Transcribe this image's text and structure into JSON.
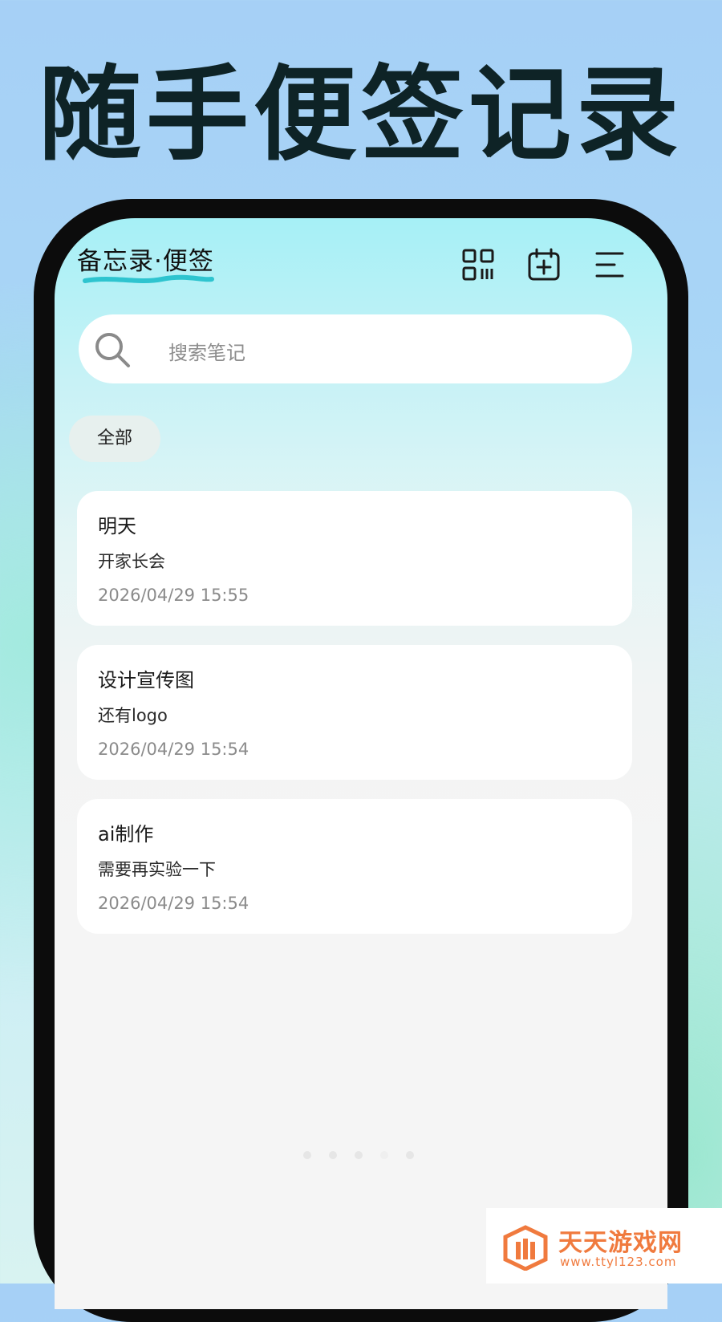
{
  "promo": {
    "title": "随手便签记录"
  },
  "app": {
    "title": "备忘录·便签",
    "icons": [
      "grid-icon",
      "calendar-add-icon",
      "menu-icon"
    ],
    "search": {
      "placeholder": "搜索笔记"
    },
    "filter_chip": "全部",
    "notes": [
      {
        "title": "明天",
        "body": "开家长会",
        "date": "2026/04/29 15:55"
      },
      {
        "title": "设计宣传图",
        "body": "还有logo",
        "date": "2026/04/29 15:54"
      },
      {
        "title": "ai制作",
        "body": "需要再实验一下",
        "date": "2026/04/29 15:54"
      }
    ],
    "accent_color": "#2ec4cf"
  },
  "watermark": {
    "name": "天天游戏网",
    "url": "www.ttyl123.com",
    "color": "#f07a3e"
  }
}
